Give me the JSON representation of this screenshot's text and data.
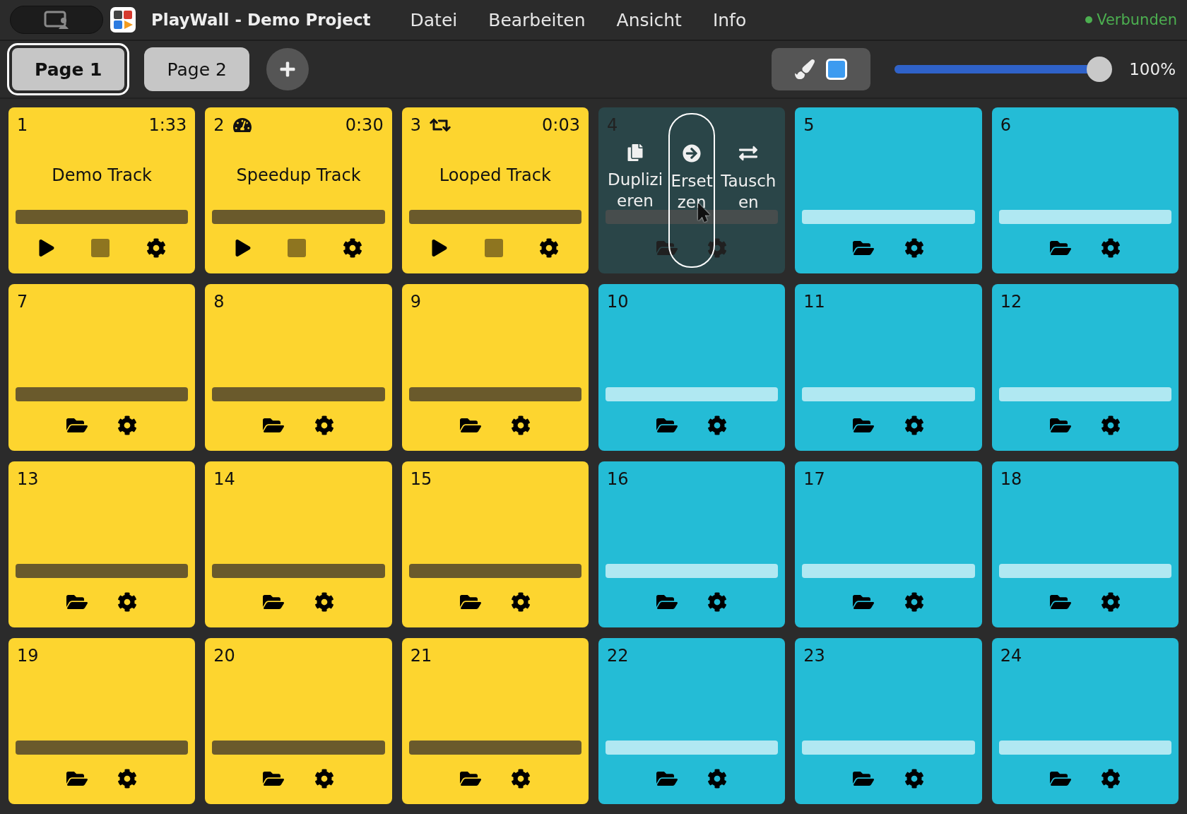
{
  "window": {
    "title": "PlayWall - Demo Project"
  },
  "menu": [
    "Datei",
    "Bearbeiten",
    "Ansicht",
    "Info"
  ],
  "status": {
    "text": "Verbunden",
    "connected": true
  },
  "pages": [
    {
      "label": "Page 1",
      "selected": true
    },
    {
      "label": "Page 2",
      "selected": false
    }
  ],
  "zoom": {
    "level": 1,
    "reading": "100%"
  },
  "cards": [
    {
      "number": "1",
      "color": "#fdd52f",
      "kind": "track",
      "title": "Demo Track",
      "duration": "1:33"
    },
    {
      "number": "2",
      "color": "#fdd52f",
      "kind": "speed",
      "title": "Speedup Track",
      "duration": "0:30"
    },
    {
      "number": "3",
      "color": "#fdd52f",
      "kind": "loop",
      "title": "Looped Track",
      "duration": "0:03"
    },
    {
      "number": "4",
      "color": "#2a4548",
      "kind": "empty",
      "actions": [
        {
          "label": "Duplizieren",
          "selected": false
        },
        {
          "label": "Ersetzen",
          "selected": true
        },
        {
          "label": "Tauschen",
          "selected": false
        }
      ]
    },
    {
      "number": "5",
      "color": "#24bcd6",
      "kind": "empty"
    },
    {
      "number": "6",
      "color": "#24bcd6",
      "kind": "empty"
    },
    {
      "number": "7",
      "color": "#fdd52f",
      "kind": "empty"
    },
    {
      "number": "8",
      "color": "#fdd52f",
      "kind": "empty"
    },
    {
      "number": "9",
      "color": "#fdd52f",
      "kind": "empty"
    },
    {
      "number": "10",
      "color": "#24bcd6",
      "kind": "empty"
    },
    {
      "number": "11",
      "color": "#24bcd6",
      "kind": "empty"
    },
    {
      "number": "12",
      "color": "#24bcd6",
      "kind": "empty"
    },
    {
      "number": "13",
      "color": "#fdd52f",
      "kind": "empty"
    },
    {
      "number": "14",
      "color": "#fdd52f",
      "kind": "empty"
    },
    {
      "number": "15",
      "color": "#fdd52f",
      "kind": "empty"
    },
    {
      "number": "16",
      "color": "#24bcd6",
      "kind": "empty"
    },
    {
      "number": "17",
      "color": "#24bcd6",
      "kind": "empty"
    },
    {
      "number": "18",
      "color": "#24bcd6",
      "kind": "empty"
    },
    {
      "number": "19",
      "color": "#fdd52f",
      "kind": "empty"
    },
    {
      "number": "20",
      "color": "#fdd52f",
      "kind": "empty"
    },
    {
      "number": "21",
      "color": "#fdd52f",
      "kind": "empty"
    },
    {
      "number": "22",
      "color": "#24bcd6",
      "kind": "empty"
    },
    {
      "number": "23",
      "color": "#24bcd6",
      "kind": "empty"
    },
    {
      "number": "24",
      "color": "#24bcd6",
      "kind": "empty"
    }
  ]
}
